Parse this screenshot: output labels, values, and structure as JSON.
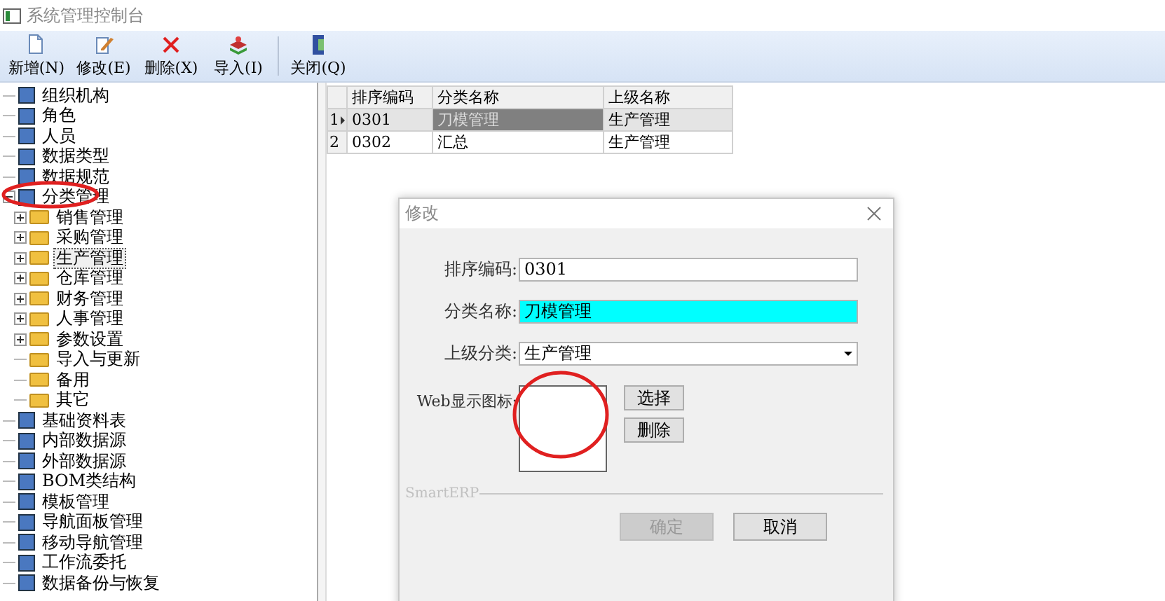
{
  "window": {
    "title": "系统管理控制台"
  },
  "toolbar": [
    {
      "label": "新增(N)",
      "kind": "new"
    },
    {
      "label": "修改(E)",
      "kind": "edit"
    },
    {
      "label": "删除(X)",
      "kind": "delete"
    },
    {
      "label": "导入(I)",
      "kind": "import"
    },
    {
      "label": "关闭(Q)",
      "kind": "close",
      "separator_before": true
    }
  ],
  "tree": [
    {
      "label": "组织机构",
      "kind": "item",
      "selected": false
    },
    {
      "label": "角色",
      "kind": "item",
      "selected": false
    },
    {
      "label": "人员",
      "kind": "item",
      "selected": false
    },
    {
      "label": "数据类型",
      "kind": "item",
      "selected": false
    },
    {
      "label": "数据规范",
      "kind": "item",
      "selected": false
    },
    {
      "label": "分类管理",
      "kind": "item",
      "selected": false,
      "expanded": true,
      "children": [
        {
          "label": "销售管理",
          "kind": "folder",
          "selected": false,
          "expanded": false
        },
        {
          "label": "采购管理",
          "kind": "folder",
          "selected": false,
          "expanded": false
        },
        {
          "label": "生产管理",
          "kind": "folder",
          "selected": true,
          "expanded": false
        },
        {
          "label": "仓库管理",
          "kind": "folder",
          "selected": false,
          "expanded": false
        },
        {
          "label": "财务管理",
          "kind": "folder",
          "selected": false,
          "expanded": false
        },
        {
          "label": "人事管理",
          "kind": "folder",
          "selected": false,
          "expanded": false
        },
        {
          "label": "参数设置",
          "kind": "folder",
          "selected": false,
          "expanded": false
        },
        {
          "label": "导入与更新",
          "kind": "folder",
          "selected": false
        },
        {
          "label": "备用",
          "kind": "folder",
          "selected": false
        },
        {
          "label": "其它",
          "kind": "folder",
          "selected": false
        }
      ]
    },
    {
      "label": "基础资料表",
      "kind": "item",
      "selected": false
    },
    {
      "label": "内部数据源",
      "kind": "item",
      "selected": false
    },
    {
      "label": "外部数据源",
      "kind": "item",
      "selected": false
    },
    {
      "label": "BOM类结构",
      "kind": "item",
      "selected": false
    },
    {
      "label": "模板管理",
      "kind": "item",
      "selected": false
    },
    {
      "label": "导航面板管理",
      "kind": "item",
      "selected": false
    },
    {
      "label": "移动导航管理",
      "kind": "item",
      "selected": false
    },
    {
      "label": "工作流委托",
      "kind": "item",
      "selected": false
    },
    {
      "label": "数据备份与恢复",
      "kind": "item",
      "selected": false
    }
  ],
  "table": {
    "columns": [
      "排序编码",
      "分类名称",
      "上级名称"
    ],
    "rows": [
      {
        "number": "1",
        "selected": true,
        "cells": [
          {
            "text": "0301",
            "focused": false
          },
          {
            "text": "刀模管理",
            "focused": true
          },
          {
            "text": "生产管理",
            "focused": false
          }
        ]
      },
      {
        "number": "2",
        "selected": false,
        "cells": [
          {
            "text": "0302",
            "focused": false
          },
          {
            "text": "汇总",
            "focused": false
          },
          {
            "text": "生产管理",
            "focused": false
          }
        ]
      }
    ]
  },
  "dialog": {
    "title": "修改",
    "fields": [
      {
        "label": "排序编码:",
        "kind": "text",
        "value": "0301",
        "highlighted": false
      },
      {
        "label": "分类名称:",
        "kind": "text",
        "value": "刀模管理",
        "highlighted": true
      },
      {
        "label": "上级分类:",
        "kind": "combo",
        "value": "生产管理",
        "highlighted": false
      }
    ],
    "icon_field": {
      "label": "Web显示图标:",
      "buttons": [
        "选择",
        "删除"
      ]
    },
    "group_label": "SmartERP",
    "buttons": [
      {
        "label": "确定",
        "disabled": true
      },
      {
        "label": "取消",
        "disabled": false
      }
    ]
  }
}
